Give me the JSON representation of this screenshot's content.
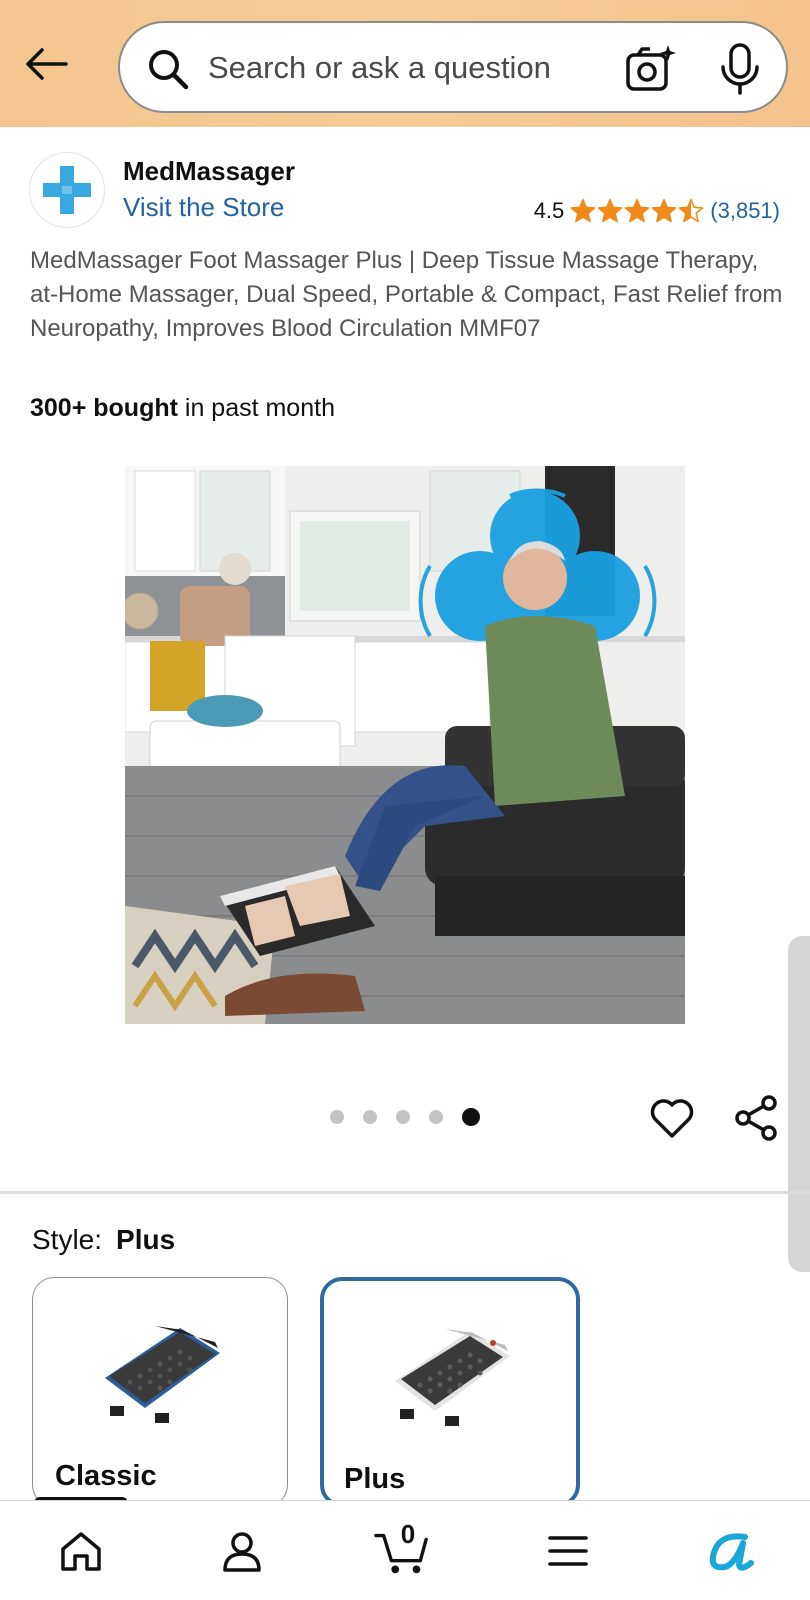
{
  "header": {
    "search_placeholder": "Search or ask a question",
    "icons": [
      "back-arrow-icon",
      "search-icon",
      "camera-icon",
      "microphone-icon"
    ]
  },
  "brand": {
    "name": "MedMassager",
    "store_link": "Visit the Store",
    "logo_color": "#3aa8e0"
  },
  "rating": {
    "value": "4.5",
    "stars": 4.5,
    "count": "(3,851)",
    "star_color": "#f08a1a"
  },
  "product": {
    "title": "MedMassager Foot Massager Plus | Deep Tissue Massage Therapy, at-Home Massager, Dual Speed, Portable & Compact, Fast Relief from Neuropathy, Improves Blood Circulation MMF07",
    "bought_bold": "300+ bought",
    "bought_rest": " in past month"
  },
  "carousel": {
    "total": 5,
    "active_index": 4
  },
  "style_selector": {
    "label": "Style:",
    "selected": "Plus",
    "options": [
      {
        "name": "Classic",
        "selected": false
      },
      {
        "name": "Plus",
        "selected": true
      }
    ],
    "selected_border_color": "#2e6a9e"
  },
  "bottom_nav": {
    "items": [
      "home-icon",
      "account-icon",
      "cart-icon",
      "menu-icon",
      "rufus-icon"
    ],
    "cart_count": "0"
  }
}
